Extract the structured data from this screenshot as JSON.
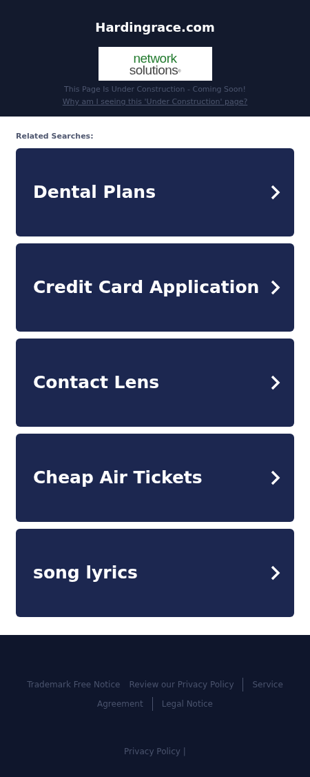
{
  "header": {
    "title": "Hardingrace.com",
    "logo": {
      "line_1": "network",
      "line_2": "solutions",
      "mark": "®"
    },
    "notice": "This Page Is Under Construction - Coming Soon!",
    "notice_link": "Why am I seeing this 'Under Construction' page?"
  },
  "related_searches": {
    "heading": "Related Searches:",
    "items": [
      {
        "label": "Dental Plans"
      },
      {
        "label": "Credit Card Application"
      },
      {
        "label": "Contact Lens"
      },
      {
        "label": "Cheap Air Tickets"
      },
      {
        "label": "song lyrics"
      }
    ]
  },
  "footer": {
    "link_rows": [
      [
        {
          "label": "Trademark Free Notice",
          "divider": false
        },
        {
          "label": "Review our Privacy Policy",
          "divider": false
        },
        {
          "label": "Service",
          "divider": true
        }
      ],
      [
        {
          "label": "Agreement",
          "divider": false
        },
        {
          "label": "Legal Notice",
          "divider": true
        }
      ]
    ],
    "privacy_link": "Privacy Policy",
    "separator": "|"
  }
}
